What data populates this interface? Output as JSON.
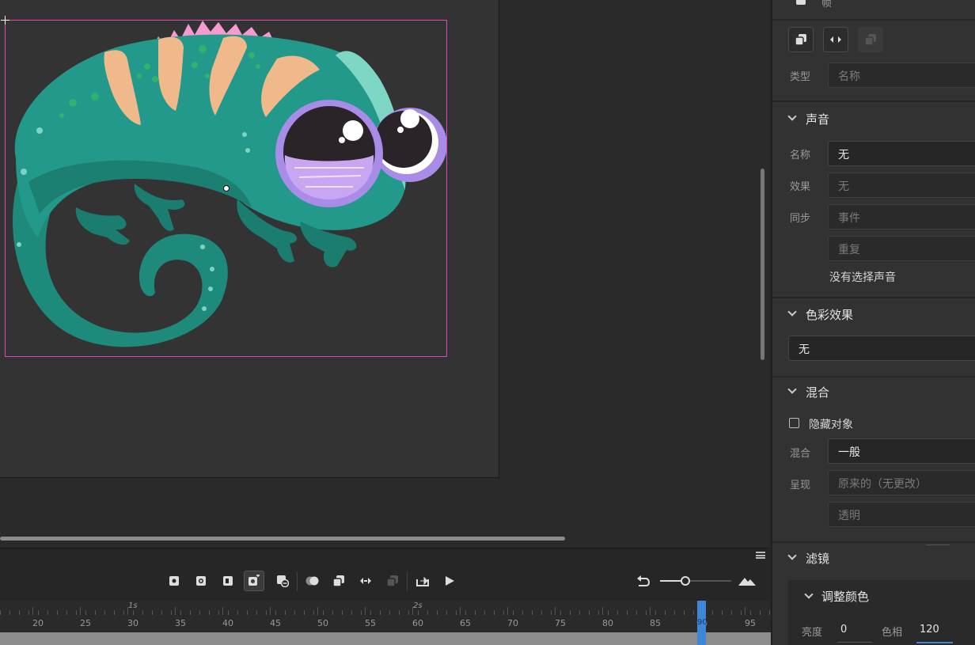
{
  "properties": {
    "frame_label": "帧",
    "type_label": "类型",
    "name_placeholder": "名称",
    "sound": {
      "title": "声音",
      "name_label": "名称",
      "name_value": "无",
      "effect_label": "效果",
      "effect_value": "无",
      "sync_label": "同步",
      "sync_value": "事件",
      "repeat_value": "重复",
      "no_sound_text": "没有选择声音"
    },
    "color_effect": {
      "title": "色彩效果",
      "value": "无"
    },
    "blend": {
      "title": "混合",
      "hide_object_label": "隐藏对象",
      "blend_label": "混合",
      "blend_value": "一般",
      "render_label": "呈现",
      "render_value": "原来的（无更改）",
      "transparent_value": "透明"
    },
    "filters": {
      "title": "滤镜",
      "adjust_color_title": "调整颜色",
      "brightness_label": "亮度",
      "brightness_value": "0",
      "hue_label": "色相",
      "hue_value": "120"
    }
  },
  "timeline": {
    "second_labels": [
      "1s",
      "2s"
    ],
    "frame_numbers": [
      "20",
      "25",
      "30",
      "35",
      "40",
      "45",
      "50",
      "55",
      "60",
      "65",
      "70",
      "75",
      "80",
      "85",
      "90",
      "95"
    ],
    "current_frame": "90",
    "zoom_level": 0.35,
    "toolbar_icons": [
      "insert-keyframe-icon",
      "insert-blank-keyframe-icon",
      "insert-frame-icon",
      "auto-keyframe-icon",
      "remove-frame-icon",
      "onion-skin-icon",
      "edit-multiple-frames-icon",
      "sync-symbols-icon",
      "paste-frames-icon",
      "loop-icon",
      "play-icon"
    ]
  },
  "colors": {
    "selection_border": "#e04ac0",
    "playhead": "#3e86d6",
    "chameleon_body": "#22998a",
    "chameleon_stripe": "#f0b98c",
    "chameleon_eye": "#a98be8",
    "crest": "#f59bd0"
  }
}
